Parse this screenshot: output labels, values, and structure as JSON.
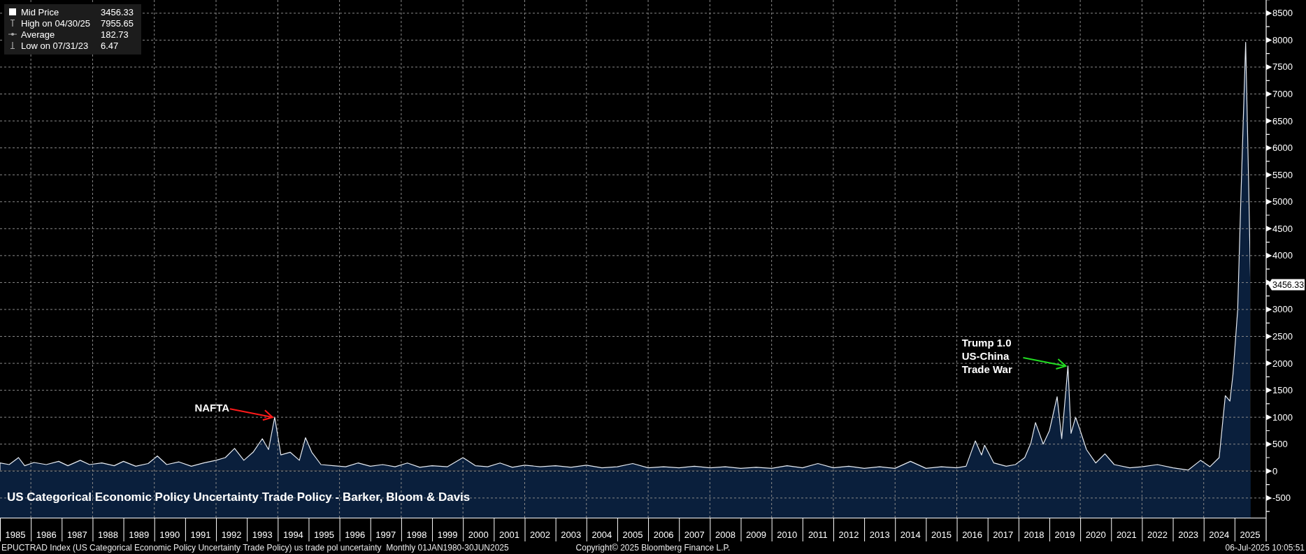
{
  "chart": {
    "legend": [
      {
        "kind": "series",
        "value": "3456.33"
      },
      {
        "kind": "high",
        "label": "High on 04/30/25",
        "value": "7955.65"
      },
      {
        "kind": "average",
        "label": "Average",
        "value": "182.73"
      },
      {
        "kind": "low",
        "label": "Low on 07/31/23",
        "value": "6.47"
      }
    ],
    "price_tag": "3456.33",
    "chart_data": {
      "type": "area",
      "title": "US Categorical Economic Policy Uncertainty Trade Policy - Barker, Bloom & Davis",
      "x": [
        1985.0,
        1985.3,
        1985.6,
        1985.8,
        1986.1,
        1986.5,
        1986.9,
        1987.2,
        1987.6,
        1987.9,
        1988.3,
        1988.7,
        1989.0,
        1989.4,
        1989.8,
        1990.1,
        1990.4,
        1990.8,
        1991.2,
        1991.6,
        1992.0,
        1992.3,
        1992.6,
        1992.9,
        1993.2,
        1993.5,
        1993.7,
        1993.9,
        1994.1,
        1994.4,
        1994.7,
        1994.9,
        1995.1,
        1995.4,
        1995.8,
        1996.2,
        1996.6,
        1997.0,
        1997.4,
        1997.8,
        1998.2,
        1998.6,
        1999.0,
        1999.5,
        2000.0,
        2000.4,
        2000.8,
        2001.2,
        2001.6,
        2002.0,
        2002.5,
        2003.0,
        2003.5,
        2004.0,
        2004.5,
        2005.0,
        2005.5,
        2006.0,
        2006.5,
        2007.0,
        2007.5,
        2008.0,
        2008.5,
        2009.0,
        2009.5,
        2010.0,
        2010.5,
        2011.0,
        2011.5,
        2012.0,
        2012.5,
        2013.0,
        2013.5,
        2014.0,
        2014.5,
        2015.0,
        2015.5,
        2016.0,
        2016.3,
        2016.6,
        2016.8,
        2016.9,
        2017.2,
        2017.6,
        2017.9,
        2018.2,
        2018.4,
        2018.55,
        2018.8,
        2019.0,
        2019.25,
        2019.4,
        2019.6,
        2019.7,
        2019.85,
        2020.0,
        2020.2,
        2020.5,
        2020.8,
        2021.1,
        2021.6,
        2022.0,
        2022.5,
        2023.0,
        2023.5,
        2023.9,
        2024.2,
        2024.5,
        2024.7,
        2024.85,
        2024.95,
        2025.1,
        2025.2,
        2025.36,
        2025.45,
        2025.52
      ],
      "series": [
        {
          "name": "Mid Price",
          "color": "#0a1f3c",
          "values": [
            150,
            120,
            250,
            100,
            160,
            120,
            180,
            100,
            200,
            120,
            150,
            100,
            180,
            90,
            140,
            280,
            120,
            170,
            90,
            150,
            200,
            250,
            420,
            200,
            350,
            600,
            400,
            1000,
            300,
            350,
            200,
            620,
            350,
            120,
            100,
            80,
            150,
            90,
            120,
            80,
            150,
            70,
            100,
            80,
            250,
            100,
            80,
            150,
            70,
            110,
            80,
            100,
            70,
            110,
            60,
            80,
            140,
            60,
            80,
            60,
            90,
            60,
            80,
            50,
            70,
            50,
            100,
            60,
            140,
            60,
            90,
            50,
            80,
            50,
            180,
            50,
            80,
            60,
            90,
            560,
            300,
            480,
            150,
            90,
            120,
            250,
            520,
            900,
            500,
            750,
            1380,
            600,
            1950,
            700,
            1000,
            750,
            400,
            150,
            320,
            120,
            60,
            80,
            120,
            60,
            20,
            200,
            80,
            250,
            1400,
            1300,
            1800,
            3000,
            5000,
            7960,
            5500,
            3460
          ]
        }
      ],
      "xlim": [
        1985,
        2026
      ],
      "ylim": [
        -865,
        8745
      ],
      "grid": true,
      "bands": [
        {
          "axis": "y",
          "from": -865,
          "to": 0,
          "color": "#0a1f3c"
        }
      ],
      "xticks": [
        {
          "value": 1985.5,
          "label": "1985"
        },
        {
          "value": 1986.5,
          "label": "1986"
        },
        {
          "value": 1987.5,
          "label": "1987"
        },
        {
          "value": 1988.5,
          "label": "1988"
        },
        {
          "value": 1989.5,
          "label": "1989"
        },
        {
          "value": 1990.5,
          "label": "1990"
        },
        {
          "value": 1991.5,
          "label": "1991"
        },
        {
          "value": 1992.5,
          "label": "1992"
        },
        {
          "value": 1993.5,
          "label": "1993"
        },
        {
          "value": 1994.5,
          "label": "1994"
        },
        {
          "value": 1995.5,
          "label": "1995"
        },
        {
          "value": 1996.5,
          "label": "1996"
        },
        {
          "value": 1997.5,
          "label": "1997"
        },
        {
          "value": 1998.5,
          "label": "1998"
        },
        {
          "value": 1999.5,
          "label": "1999"
        },
        {
          "value": 2000.5,
          "label": "2000"
        },
        {
          "value": 2001.5,
          "label": "2001"
        },
        {
          "value": 2002.5,
          "label": "2002"
        },
        {
          "value": 2003.5,
          "label": "2003"
        },
        {
          "value": 2004.5,
          "label": "2004"
        },
        {
          "value": 2005.5,
          "label": "2005"
        },
        {
          "value": 2006.5,
          "label": "2006"
        },
        {
          "value": 2007.5,
          "label": "2007"
        },
        {
          "value": 2008.5,
          "label": "2008"
        },
        {
          "value": 2009.5,
          "label": "2009"
        },
        {
          "value": 2010.5,
          "label": "2010"
        },
        {
          "value": 2011.5,
          "label": "2011"
        },
        {
          "value": 2012.5,
          "label": "2012"
        },
        {
          "value": 2013.5,
          "label": "2013"
        },
        {
          "value": 2014.5,
          "label": "2014"
        },
        {
          "value": 2015.5,
          "label": "2015"
        },
        {
          "value": 2016.5,
          "label": "2016"
        },
        {
          "value": 2017.5,
          "label": "2017"
        },
        {
          "value": 2018.5,
          "label": "2018"
        },
        {
          "value": 2019.5,
          "label": "2019"
        },
        {
          "value": 2020.5,
          "label": "2020"
        },
        {
          "value": 2021.5,
          "label": "2021"
        },
        {
          "value": 2022.5,
          "label": "2022"
        },
        {
          "value": 2023.5,
          "label": "2023"
        },
        {
          "value": 2024.5,
          "label": "2024"
        },
        {
          "value": 2025.5,
          "label": "2025"
        }
      ],
      "yticks": [
        -500,
        0,
        500,
        1000,
        1500,
        2000,
        2500,
        3000,
        4000,
        4500,
        5000,
        5500,
        6000,
        6500,
        7000,
        7500,
        8000,
        8500
      ],
      "annotations": [
        {
          "text": "NAFTA",
          "x": 1993.9,
          "y": 1000
        },
        {
          "text": "Trump 1.0\nUS-China\nTrade War",
          "x": 2019.6,
          "y": 1950
        }
      ]
    }
  },
  "footer": {
    "description": "EPUCTRAD Index (US Categorical Economic Policy Uncertainty Trade Policy) us trade pol uncertainty  Monthly 01JAN1980-30JUN2025",
    "copyright": "Copyright© 2025 Bloomberg Finance L.P.",
    "timestamp": "06-Jul-2025 10:05:51"
  }
}
